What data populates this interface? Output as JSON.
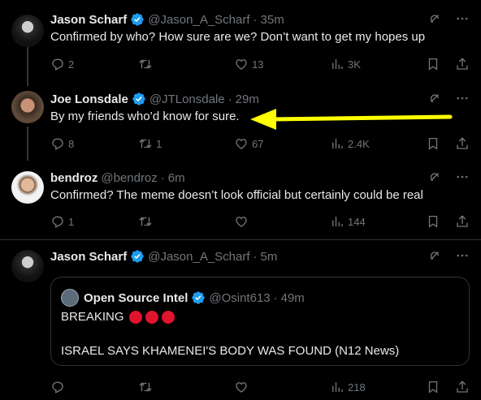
{
  "colors": {
    "verified": "#1d9bf0",
    "annotation_arrow": "#ffff00",
    "breaking_dot": "#e0142d"
  },
  "posts": [
    {
      "name": "Jason Scharf",
      "handle": "@Jason_A_Scharf",
      "time": "35m",
      "text": "Confirmed by who? How sure are we? Don’t want to get my hopes up",
      "replies": "2",
      "reposts": "",
      "likes": "13",
      "views": "3K"
    },
    {
      "name": "Joe Lonsdale",
      "handle": "@JTLonsdale",
      "time": "29m",
      "text": "By my friends who’d know for sure.",
      "replies": "8",
      "reposts": "1",
      "likes": "67",
      "views": "2.4K"
    },
    {
      "name": "bendroz",
      "handle": "@bendroz",
      "time": "6m",
      "text": "Confirmed? The meme doesn’t look official but certainly could be real",
      "replies": "1",
      "reposts": "",
      "likes": "",
      "views": "144"
    },
    {
      "name": "Jason Scharf",
      "handle": "@Jason_A_Scharf",
      "time": "5m",
      "text": "",
      "replies": "",
      "reposts": "",
      "likes": "",
      "views": "218"
    }
  ],
  "quote": {
    "name": "Open Source Intel",
    "handle": "@Osint613",
    "time": "49m",
    "line1": "BREAKING",
    "line2": "ISRAEL SAYS KHAMENEI'S BODY WAS FOUND (N12 News)"
  },
  "separator": "·"
}
